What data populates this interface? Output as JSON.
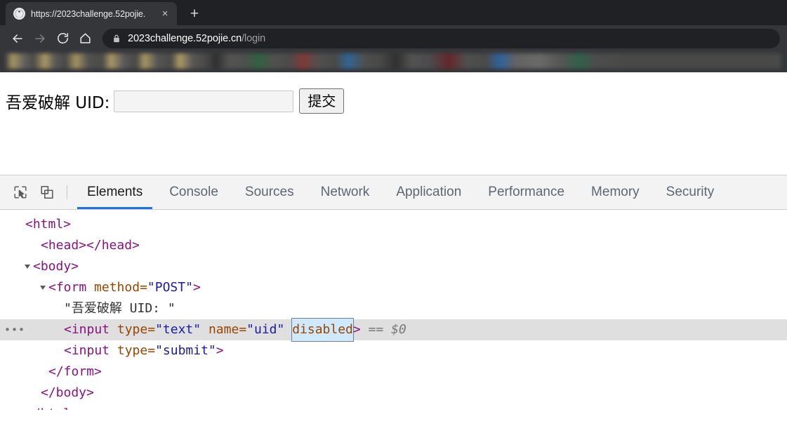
{
  "browser": {
    "tab": {
      "title": "https://2023challenge.52pojie.",
      "close_label": "×",
      "favicon_name": "globe-icon"
    },
    "new_tab_label": "+",
    "nav": {
      "back_label": "Back",
      "forward_label": "Forward",
      "reload_label": "Reload",
      "home_label": "Home"
    },
    "omnibox": {
      "host": "2023challenge.52pojie.cn",
      "path": "/login",
      "lock_label": "Secure"
    },
    "bookmarks_bar_label": "Bookmarks (blurred)"
  },
  "page": {
    "form_label": "吾爱破解 UID:",
    "uid_input_value": "",
    "uid_input_placeholder": "",
    "submit_label": "提交"
  },
  "devtools": {
    "inspect_icon": "inspect-element-icon",
    "device_icon": "device-toolbar-icon",
    "tabs": [
      {
        "label": "Elements",
        "active": true
      },
      {
        "label": "Console",
        "active": false
      },
      {
        "label": "Sources",
        "active": false
      },
      {
        "label": "Network",
        "active": false
      },
      {
        "label": "Application",
        "active": false
      },
      {
        "label": "Performance",
        "active": false
      },
      {
        "label": "Memory",
        "active": false
      },
      {
        "label": "Security",
        "active": false
      }
    ],
    "accent_color": "#1a73e8",
    "selected_row_bg": "#dfdfdf",
    "dom": {
      "line_html_open": "<html>",
      "line_head": "<head></head>",
      "line_body_open": "<body>",
      "line_form_tag": "<form",
      "line_form_attr": "method",
      "line_form_attr_eq": "=",
      "line_form_attr_val": "\"POST\"",
      "line_form_close_bracket": ">",
      "line_textnode": "\"吾爱破解 UID: \"",
      "input_text_tag": "<input",
      "input_text_attr1": "type",
      "input_text_val1": "\"text\"",
      "input_text_attr2": "name",
      "input_text_val2": "\"uid\"",
      "input_text_attr3": "disabled",
      "input_text_close": ">",
      "input_text_suffix": "== $0",
      "gutter_more": "•••",
      "input_submit_tag": "<input",
      "input_submit_attr1": "type",
      "input_submit_val1": "\"submit\"",
      "input_submit_close": ">",
      "line_form_end": "</form>",
      "line_body_end": "</body>",
      "line_html_end": "</html>",
      "eq": "="
    }
  }
}
